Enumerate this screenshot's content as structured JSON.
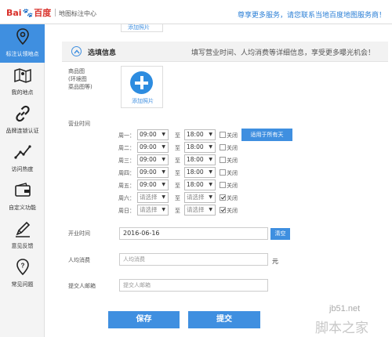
{
  "header": {
    "logo_part1": "Bai",
    "logo_part2": "百度",
    "subtitle": "地图标注中心",
    "right_text": "尊享更多服务，请您联系当地百度地图服务商！"
  },
  "sidebar": {
    "items": [
      {
        "label": "标注认领地点",
        "icon": "location-pin-icon"
      },
      {
        "label": "我的地点",
        "icon": "map-icon"
      },
      {
        "label": "品牌连锁认证",
        "icon": "link-chain-icon"
      },
      {
        "label": "访问热度",
        "icon": "line-chart-icon"
      },
      {
        "label": "自定义功能",
        "icon": "wallet-icon"
      },
      {
        "label": "意见反馈",
        "icon": "pencil-icon"
      },
      {
        "label": "常见问题",
        "icon": "help-question-icon"
      }
    ],
    "active_index": 0
  },
  "prev_card": {
    "label": "添加照片"
  },
  "section": {
    "title": "选填信息",
    "hint": "填写营业时间、人均消费等详细信息，享受更多曝光机会！"
  },
  "photos": {
    "label_line1": "商品图",
    "label_line2": "(环境图",
    "label_line3": "菜品图等)",
    "add_label": "添加照片"
  },
  "hours": {
    "label": "营业时间",
    "to_label": "至",
    "closed_label": "关闭",
    "apply_all_label": "适用于所有天",
    "days": [
      {
        "day": "周一：",
        "start": "09:00",
        "end": "18:00",
        "closed": false
      },
      {
        "day": "周二：",
        "start": "09:00",
        "end": "18:00",
        "closed": false
      },
      {
        "day": "周三：",
        "start": "09:00",
        "end": "18:00",
        "closed": false
      },
      {
        "day": "周四：",
        "start": "09:00",
        "end": "18:00",
        "closed": false
      },
      {
        "day": "周五：",
        "start": "09:00",
        "end": "18:00",
        "closed": false
      },
      {
        "day": "周六：",
        "start": "请选择",
        "end": "请选择",
        "closed": true
      },
      {
        "day": "周日：",
        "start": "请选择",
        "end": "请选择",
        "closed": true
      }
    ]
  },
  "opening": {
    "label": "开业时间",
    "value": "2016-06-16",
    "clear_label": "清空"
  },
  "avg_cost": {
    "label": "人均消费",
    "placeholder": "人均消费",
    "unit": "元"
  },
  "email": {
    "label": "提交人邮箱",
    "placeholder": "提交人邮箱"
  },
  "actions": {
    "save_label": "保存",
    "submit_label": "提交"
  },
  "watermark": {
    "line1": "jb51.net",
    "line2": "脚本之家"
  }
}
